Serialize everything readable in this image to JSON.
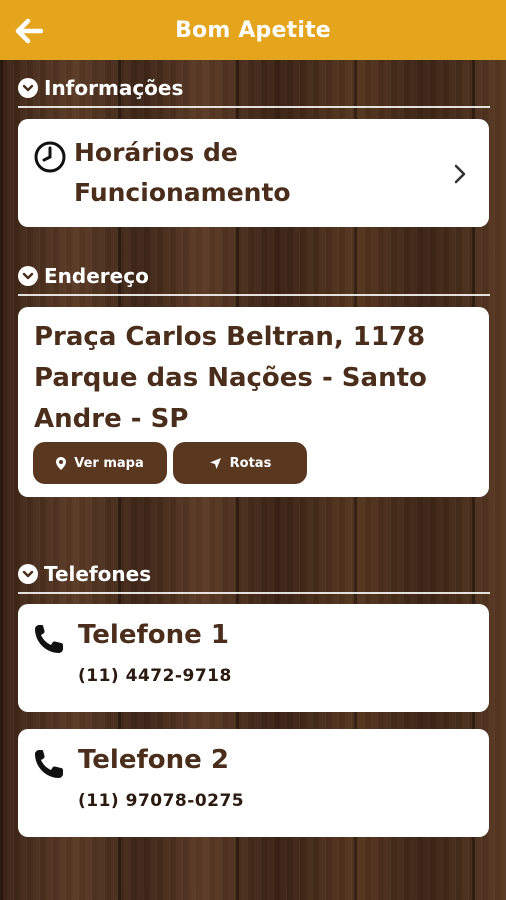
{
  "header": {
    "title": "Bom Apetite",
    "back_icon": "arrow-left-icon",
    "bar_color": "#e4a41c"
  },
  "sections": {
    "info": {
      "label": "Informações",
      "icon": "chevron-down-circle-icon"
    },
    "address": {
      "label": "Endereço",
      "icon": "chevron-down-circle-icon"
    },
    "phones": {
      "label": "Telefones",
      "icon": "chevron-down-circle-icon"
    }
  },
  "hours": {
    "label_line1": "Horários de",
    "label_line2": "Funcionamento",
    "icon": "clock-icon",
    "nav_icon": "chevron-right-icon"
  },
  "address": {
    "line1": "Praça Carlos Beltran, 1178",
    "line2": "Parque das Nações - Santo",
    "line3": "Andre - SP",
    "map_button": "Ver mapa",
    "map_icon": "map-pin-icon",
    "route_button": "Rotas",
    "route_icon": "navigation-arrow-icon",
    "button_color": "#5a3820"
  },
  "phones": [
    {
      "label": "Telefone 1",
      "number": "(11) 4472-9718",
      "icon": "phone-icon"
    },
    {
      "label": "Telefone 2",
      "number": "(11) 97078-0275",
      "icon": "phone-icon"
    }
  ],
  "colors": {
    "text_brown": "#4a2d1a",
    "card_bg": "#ffffff"
  }
}
